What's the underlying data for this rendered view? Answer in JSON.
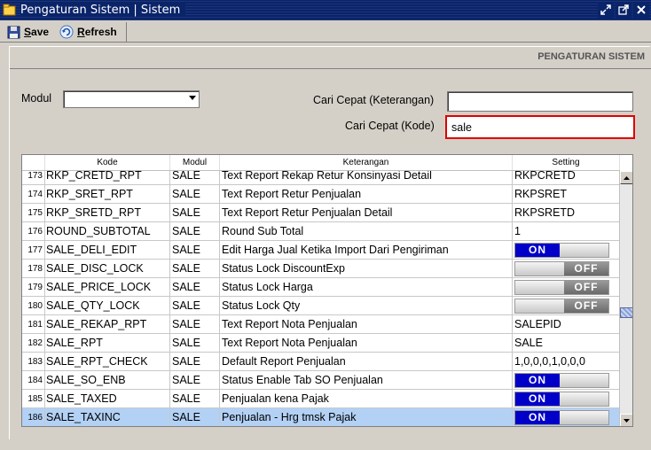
{
  "window": {
    "title": "Pengaturan Sistem | Sistem"
  },
  "toolbar": {
    "save_prefix": "S",
    "save_rest": "ave",
    "refresh_prefix": "R",
    "refresh_rest": "efresh"
  },
  "panel": {
    "title": "PENGATURAN SISTEM"
  },
  "filters": {
    "modul_label": "Modul",
    "modul_value": "",
    "cari_ket_label": "Cari Cepat (Keterangan)",
    "cari_ket_value": "",
    "cari_kode_label": "Cari Cepat (Kode)",
    "cari_kode_value": "sale"
  },
  "grid": {
    "columns": [
      "Kode",
      "Modul",
      "Keterangan",
      "Setting"
    ],
    "rows": [
      {
        "no": "173",
        "kode": "RKP_CRETD_RPT",
        "modul": "SALE",
        "ket": "Text Report Rekap Retur Konsinyasi Detail",
        "setting": "RKPCRETD",
        "type": "text"
      },
      {
        "no": "174",
        "kode": "RKP_SRET_RPT",
        "modul": "SALE",
        "ket": "Text Report Retur Penjualan",
        "setting": "RKPSRET",
        "type": "text"
      },
      {
        "no": "175",
        "kode": "RKP_SRETD_RPT",
        "modul": "SALE",
        "ket": "Text Report Retur Penjualan Detail",
        "setting": "RKPSRETD",
        "type": "text"
      },
      {
        "no": "176",
        "kode": "ROUND_SUBTOTAL",
        "modul": "SALE",
        "ket": "Round Sub Total",
        "setting": "1",
        "type": "text"
      },
      {
        "no": "177",
        "kode": "SALE_DELI_EDIT",
        "modul": "SALE",
        "ket": "Edit Harga Jual Ketika Import Dari Pengiriman",
        "setting": "ON",
        "type": "on"
      },
      {
        "no": "178",
        "kode": "SALE_DISC_LOCK",
        "modul": "SALE",
        "ket": "Status Lock DiscountExp",
        "setting": "OFF",
        "type": "off"
      },
      {
        "no": "179",
        "kode": "SALE_PRICE_LOCK",
        "modul": "SALE",
        "ket": "Status Lock Harga",
        "setting": "OFF",
        "type": "off"
      },
      {
        "no": "180",
        "kode": "SALE_QTY_LOCK",
        "modul": "SALE",
        "ket": "Status Lock Qty",
        "setting": "OFF",
        "type": "off"
      },
      {
        "no": "181",
        "kode": "SALE_REKAP_RPT",
        "modul": "SALE",
        "ket": "Text Report Nota Penjualan",
        "setting": "SALEPID",
        "type": "text"
      },
      {
        "no": "182",
        "kode": "SALE_RPT",
        "modul": "SALE",
        "ket": "Text Report Nota Penjualan",
        "setting": "SALE",
        "type": "text"
      },
      {
        "no": "183",
        "kode": "SALE_RPT_CHECK",
        "modul": "SALE",
        "ket": "Default Report Penjualan",
        "setting": "1,0,0,0,1,0,0,0",
        "type": "text"
      },
      {
        "no": "184",
        "kode": "SALE_SO_ENB",
        "modul": "SALE",
        "ket": "Status Enable Tab SO Penjualan",
        "setting": "ON",
        "type": "on"
      },
      {
        "no": "185",
        "kode": "SALE_TAXED",
        "modul": "SALE",
        "ket": "Penjualan kena Pajak",
        "setting": "ON",
        "type": "on"
      },
      {
        "no": "186",
        "kode": "SALE_TAXINC",
        "modul": "SALE",
        "ket": "Penjualan - Hrg tmsk Pajak",
        "setting": "ON",
        "type": "on",
        "selected": true
      }
    ]
  },
  "colors": {
    "titlebar": "#0a246a",
    "toggle_on": "#0000c8",
    "selected_row": "#b3d1f5",
    "search_highlight": "#e00000"
  }
}
